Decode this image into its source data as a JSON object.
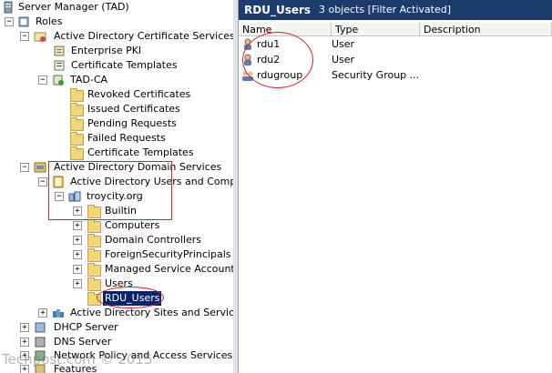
{
  "tree": {
    "items": [
      {
        "label": "Server Manager (TAD)",
        "icon": "server-icon"
      },
      {
        "label": "Roles",
        "icon": "roles-icon"
      },
      {
        "label": "Active Directory Certificate Services",
        "icon": "certificate-services-icon"
      },
      {
        "label": "Enterprise PKI",
        "icon": "pki-icon"
      },
      {
        "label": "Certificate Templates",
        "icon": "certificate-templates-icon"
      },
      {
        "label": "TAD-CA",
        "icon": "ca-icon"
      },
      {
        "label": "Revoked Certificates",
        "icon": "folder-icon"
      },
      {
        "label": "Issued Certificates",
        "icon": "folder-icon"
      },
      {
        "label": "Pending Requests",
        "icon": "folder-icon"
      },
      {
        "label": "Failed Requests",
        "icon": "folder-icon"
      },
      {
        "label": "Certificate Templates",
        "icon": "folder-icon"
      },
      {
        "label": "Active Directory Domain Services",
        "icon": "domain-services-icon"
      },
      {
        "label": "Active Directory Users and Computer",
        "icon": "users-computers-icon"
      },
      {
        "label": "troycity.org",
        "icon": "domain-icon"
      },
      {
        "label": "Builtin",
        "icon": "folder-icon"
      },
      {
        "label": "Computers",
        "icon": "folder-icon"
      },
      {
        "label": "Domain Controllers",
        "icon": "ou-folder-icon"
      },
      {
        "label": "ForeignSecurityPrincipals",
        "icon": "folder-icon"
      },
      {
        "label": "Managed Service Accounts",
        "icon": "folder-icon"
      },
      {
        "label": "Users",
        "icon": "folder-icon"
      },
      {
        "label": "RDU_Users",
        "icon": "ou-folder-icon"
      },
      {
        "label": "Active Directory Sites and Services",
        "icon": "sites-services-icon"
      },
      {
        "label": "DHCP Server",
        "icon": "dhcp-icon"
      },
      {
        "label": "DNS Server",
        "icon": "dns-icon"
      },
      {
        "label": "Network Policy and Access Services",
        "icon": "network-policy-icon"
      },
      {
        "label": "Features",
        "icon": "features-icon"
      }
    ]
  },
  "header": {
    "title": "RDU_Users",
    "count": "3 objects  [Filter Activated]"
  },
  "columns": [
    "Name",
    "Type",
    "Description"
  ],
  "rows": [
    {
      "name": "rdu1",
      "type": "User",
      "icon": "user-icon"
    },
    {
      "name": "rdu2",
      "type": "User",
      "icon": "user-icon"
    },
    {
      "name": "rdugroup",
      "type": "Security Group ...",
      "icon": "group-icon"
    }
  ],
  "watermark": "Techpost.com © 2015",
  "colors": {
    "header_bg": "#1c3c6e",
    "selection": "#0a246a",
    "annotation": "#e02020"
  }
}
